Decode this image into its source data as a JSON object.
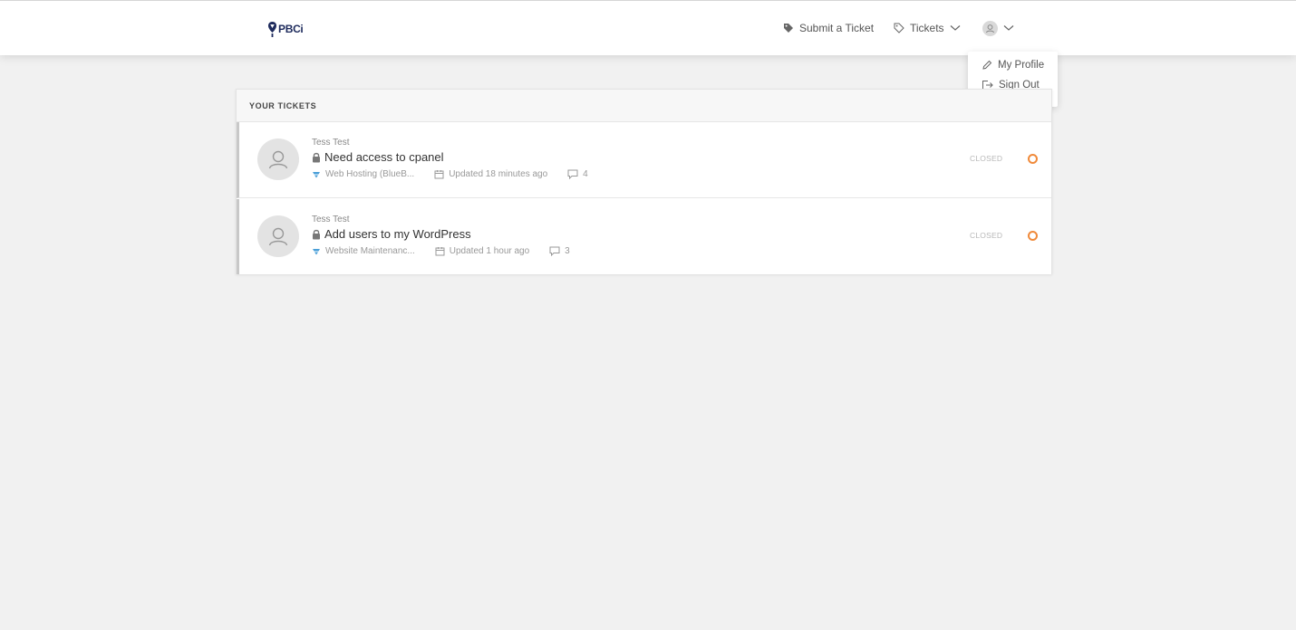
{
  "brand": {
    "logo_text": "PBCi"
  },
  "nav": {
    "submit_label": "Submit a Ticket",
    "tickets_label": "Tickets"
  },
  "user_menu": {
    "items": [
      {
        "label": "My Profile",
        "icon": "pencil-icon"
      },
      {
        "label": "Sign Out",
        "icon": "sign-out-icon"
      }
    ]
  },
  "tickets_panel": {
    "title": "YOUR TICKETS",
    "tickets": [
      {
        "author": "Tess Test",
        "subject": "Need access to cpanel",
        "category": "Web Hosting (BlueB...",
        "updated": "Updated 18 minutes ago",
        "comments": "4",
        "status": "CLOSED"
      },
      {
        "author": "Tess Test",
        "subject": "Add users to my WordPress",
        "category": "Website Maintenanc...",
        "updated": "Updated 1 hour ago",
        "comments": "3",
        "status": "CLOSED"
      }
    ]
  },
  "colors": {
    "background": "#f1f1f1",
    "status_dot": "#f08a3a",
    "category_icon": "#4a9fd8",
    "logo": "#1d2a5c"
  }
}
